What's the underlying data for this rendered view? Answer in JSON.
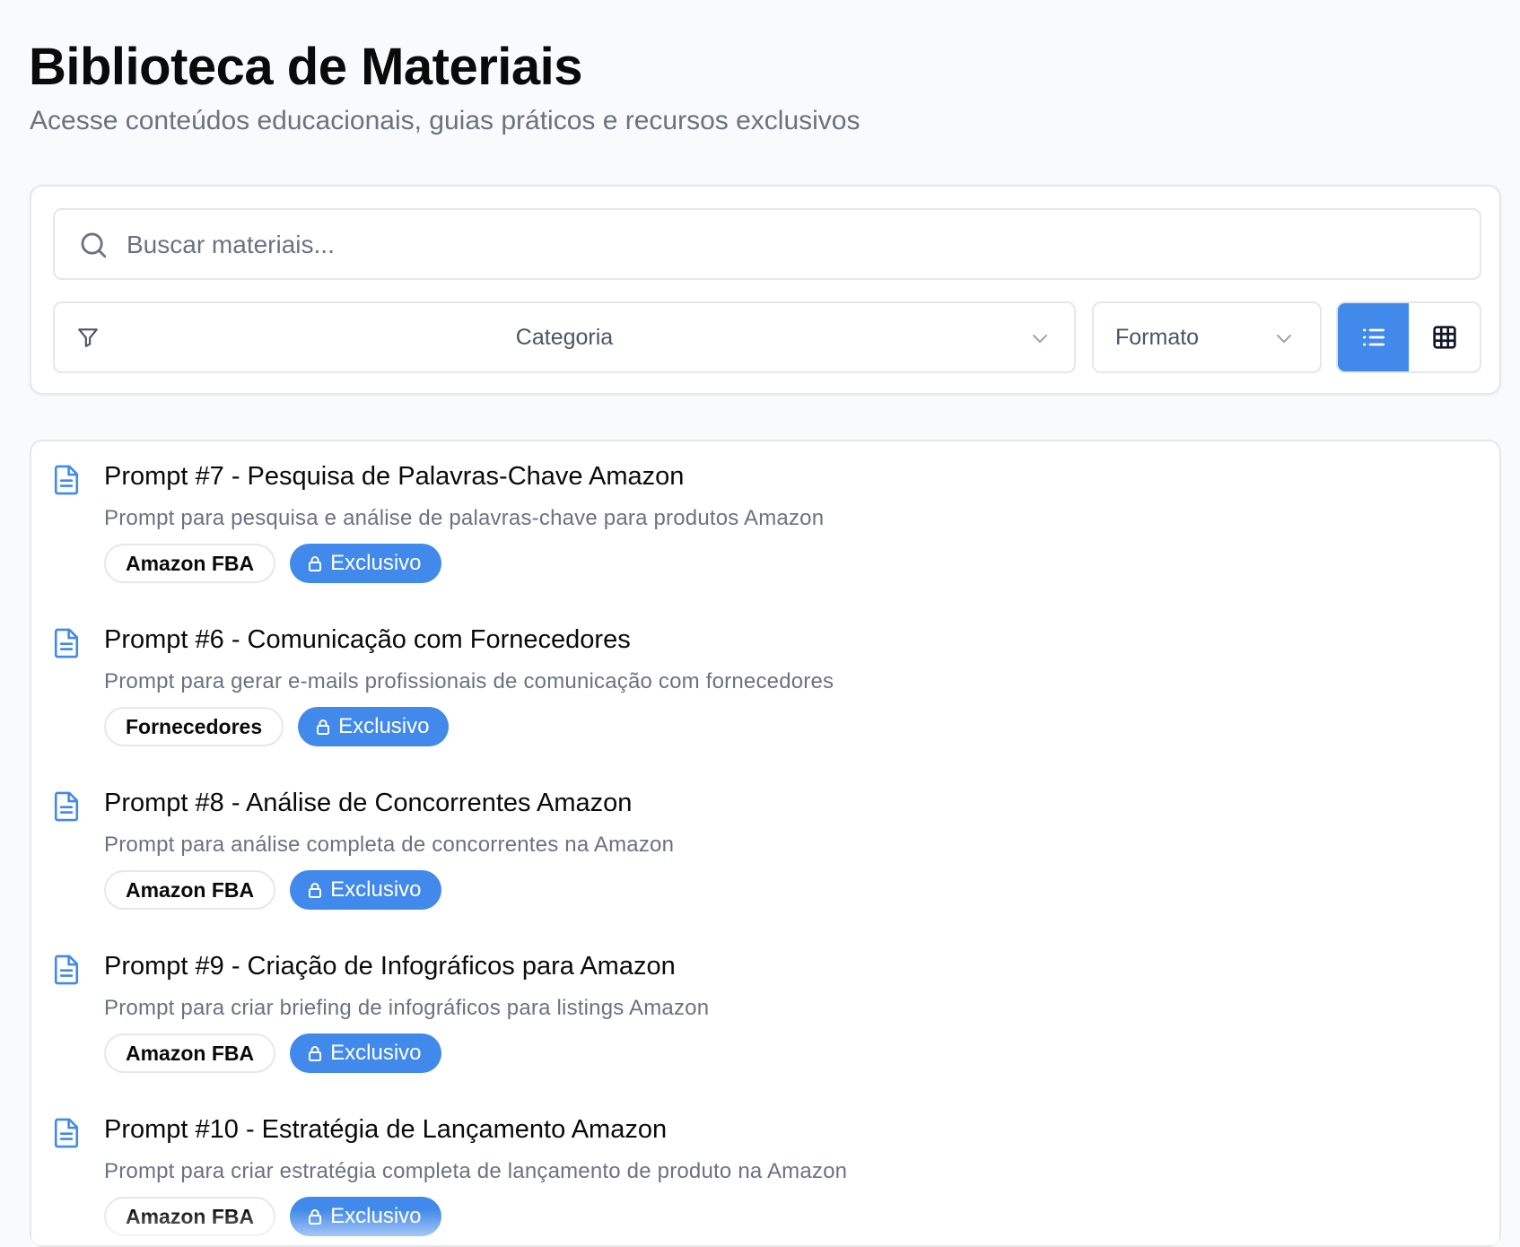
{
  "header": {
    "title": "Biblioteca de Materiais",
    "subtitle": "Acesse conteúdos educacionais, guias práticos e recursos exclusivos"
  },
  "filters": {
    "search_placeholder": "Buscar materiais...",
    "category_label": "Categoria",
    "format_label": "Formato",
    "view_mode": "list",
    "accent_color": "#4189ea"
  },
  "materials": [
    {
      "title": "Prompt #7 - Pesquisa de Palavras-Chave Amazon",
      "description": "Prompt para pesquisa e análise de palavras-chave para produtos Amazon",
      "category": "Amazon FBA",
      "badge": "Exclusivo",
      "icon": "document-icon"
    },
    {
      "title": "Prompt #6 - Comunicação com Fornecedores",
      "description": "Prompt para gerar e-mails profissionais de comunicação com fornecedores",
      "category": "Fornecedores",
      "badge": "Exclusivo",
      "icon": "document-icon"
    },
    {
      "title": "Prompt #8 - Análise de Concorrentes Amazon",
      "description": "Prompt para análise completa de concorrentes na Amazon",
      "category": "Amazon FBA",
      "badge": "Exclusivo",
      "icon": "document-icon"
    },
    {
      "title": "Prompt #9 - Criação de Infográficos para Amazon",
      "description": "Prompt para criar briefing de infográficos para listings Amazon",
      "category": "Amazon FBA",
      "badge": "Exclusivo",
      "icon": "document-icon"
    },
    {
      "title": "Prompt #10 - Estratégia de Lançamento Amazon",
      "description": "Prompt para criar estratégia completa de lançamento de produto na Amazon",
      "category": "Amazon FBA",
      "badge": "Exclusivo",
      "icon": "document-icon"
    }
  ]
}
